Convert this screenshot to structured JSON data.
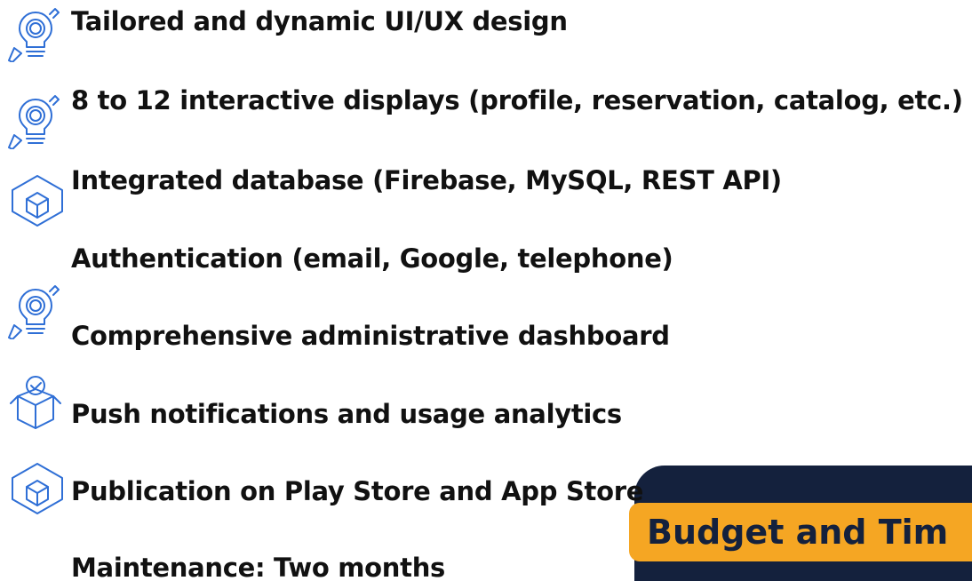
{
  "features": [
    "Tailored and dynamic UI/UX design",
    "8 to 12 interactive displays (profile, reservation, catalog, etc.)",
    "Integrated database (Firebase, MySQL, REST API)",
    "Authentication (email, Google, telephone)",
    "Comprehensive administrative dashboard",
    "Push notifications and usage analytics",
    "Publication on Play Store and App Store",
    "Maintenance: Two months"
  ],
  "budget": {
    "title": "Budget and Tim"
  },
  "colors": {
    "icon_stroke": "#2f6fd6",
    "card_background": "#14213d",
    "tag_background": "#f5a623",
    "text": "#111111"
  },
  "icons": [
    "lightbulb-gear-icon",
    "lightbulb-gear-icon",
    "cube-icon",
    "lightbulb-gear-icon",
    "box-check-icon",
    "cube-icon"
  ]
}
